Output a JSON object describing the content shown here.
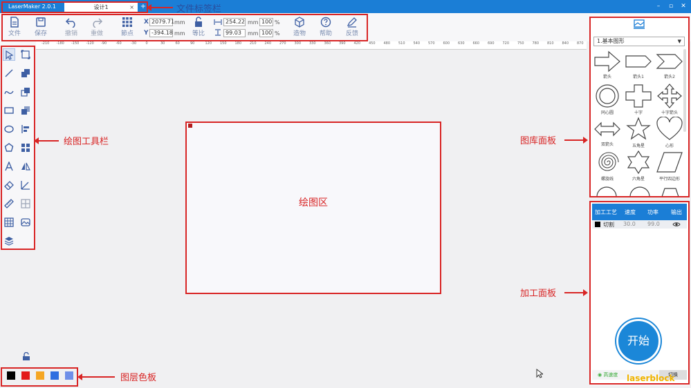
{
  "titlebar": {
    "app_tab": "LaserMaker 2.0.1",
    "doc_tab": "设计1",
    "close_glyph": "×",
    "add_glyph": "+",
    "min_glyph": "–",
    "max_glyph": "▫",
    "win_close_glyph": "✕"
  },
  "toolbar": {
    "file": "文件",
    "save": "保存",
    "undo": "撤销",
    "redo": "重做",
    "node": "節点",
    "x_label": "X",
    "y_label": "Y",
    "x_value": "2079.71",
    "y_value": "-394.18",
    "width_value": "254.22",
    "height_value": "99.03",
    "unit": "mm",
    "scale_w": "100",
    "scale_h": "100",
    "percent": "%",
    "ratio": "等比",
    "create": "造物",
    "help": "帮助",
    "feedback": "反馈"
  },
  "ruler": {
    "ticks": [
      "-210",
      "-180",
      "-150",
      "-120",
      "-90",
      "-60",
      "-30",
      "0",
      "30",
      "60",
      "90",
      "120",
      "150",
      "180",
      "210",
      "240",
      "270",
      "300",
      "330",
      "360",
      "390",
      "420",
      "450",
      "480",
      "510",
      "540",
      "570",
      "600",
      "630",
      "660",
      "690",
      "720",
      "750",
      "780",
      "810",
      "840",
      "870"
    ]
  },
  "canvas": {
    "label": "绘图区"
  },
  "annotations": {
    "tab_bar": "文件标签栏",
    "draw_tools": "绘图工具栏",
    "library": "图库面板",
    "process": "加工面板",
    "layer_colors": "图层色板"
  },
  "layer_colors": [
    "#000000",
    "#e31b1b",
    "#f5a623",
    "#2f6fe0",
    "#6f8fe8"
  ],
  "library": {
    "select_value": "1.基本图形",
    "shapes": [
      "箭头",
      "箭头1",
      "箭头2",
      "同心圆",
      "十字",
      "十字箭头",
      "双箭头",
      "五角星",
      "心形",
      "螺旋线",
      "六角星",
      "平行四边形"
    ]
  },
  "process": {
    "headers": [
      "加工工艺",
      "速度",
      "功率",
      "输出"
    ],
    "row": {
      "mode": "切割",
      "speed": "30.0",
      "power": "99.0"
    },
    "start": "开始",
    "speed_toggle": "◉ 高速度",
    "switch": "切换"
  },
  "watermark": "laserblock",
  "colors": {
    "accent": "#1b7ed6",
    "annotation": "#d82424"
  }
}
